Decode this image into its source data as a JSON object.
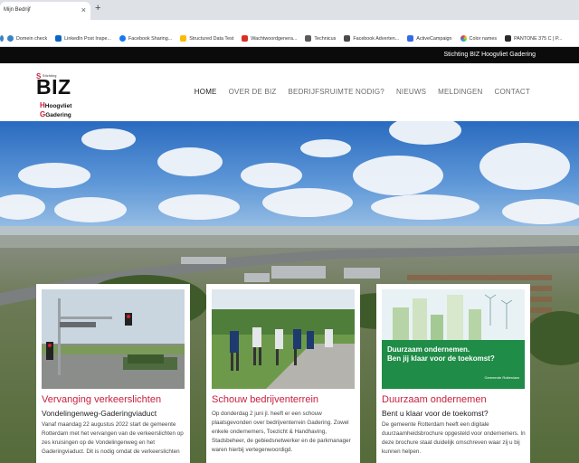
{
  "browser": {
    "tab_title": "Mijn Bedrijf",
    "tab_close": "×",
    "new_tab": "+",
    "bookmarks": [
      {
        "label": "Domein check",
        "color": "#3b82c4"
      },
      {
        "label": "LinkedIn Post Inspe...",
        "color": "#0a66c2"
      },
      {
        "label": "Facebook Sharing...",
        "color": "#1877f2"
      },
      {
        "label": "Structured Data Test",
        "color": "#fbbc05"
      },
      {
        "label": "Wachtwoordgenera...",
        "color": "#d93025"
      },
      {
        "label": "Technicus",
        "color": "#5a5a5a"
      },
      {
        "label": "Facebook Adverten...",
        "color": "#1877f2"
      },
      {
        "label": "ActiveCampaign",
        "color": "#356ae6"
      },
      {
        "label": "Color names",
        "color": "#8e44ad"
      },
      {
        "label": "PANTONE 375 C | P...",
        "color": "#e74c3c"
      }
    ]
  },
  "topbar": {
    "text": "Stichting BIZ Hoogvliet Gadering"
  },
  "logo": {
    "stichting": "Stichting",
    "biz": "BIZ",
    "line1": "Hoogvliet",
    "line2": "Gadering",
    "accent": "#c81e3c"
  },
  "nav": [
    {
      "label": "HOME"
    },
    {
      "label": "OVER DE BIZ"
    },
    {
      "label": "BEDRIJFSRUIMTE NODIG?"
    },
    {
      "label": "NIEUWS"
    },
    {
      "label": "MELDINGEN"
    },
    {
      "label": "CONTACT"
    }
  ],
  "cards": [
    {
      "title": "Vervanging verkeerslichten",
      "subtitle": "Vondelingenweg-Gaderingviaduct",
      "body": "Vanaf maandag 22 augustus 2022 start de gemeente Rotterdam met het vervangen van de verkeerslichten op zes kruisingen op de Vondelingenweg en het Gaderingviaduct. Dit is nodig omdat de verkeerslichten"
    },
    {
      "title": "Schouw bedrijventerrein",
      "subtitle": "",
      "body": "Op donderdag 2 juni jl. heeft er een schouw plaatsgevonden over bedrijventerrein Gadering. Zowel enkele ondernemers, Toezicht & Handhaving, Stadsbeheer, de gebiedsnetwerker en de parkmanager waren hierbij vertegenwoordigd."
    },
    {
      "title": "Duurzaam ondernemen",
      "subtitle": "Bent u klaar voor de toekomst?",
      "body": "De gemeente Rotterdam heeft een digitale duurzaamheidsbrochure opgesteld voor ondernemers. In deze brochure staat duidelijk omschreven waar zij u bij kunnen helpen.",
      "banner_line1": "Duurzaam ondernemen.",
      "banner_line2": "Ben jij klaar voor de toekomst?",
      "banner_logo": "Gemeente Rotterdam"
    }
  ]
}
